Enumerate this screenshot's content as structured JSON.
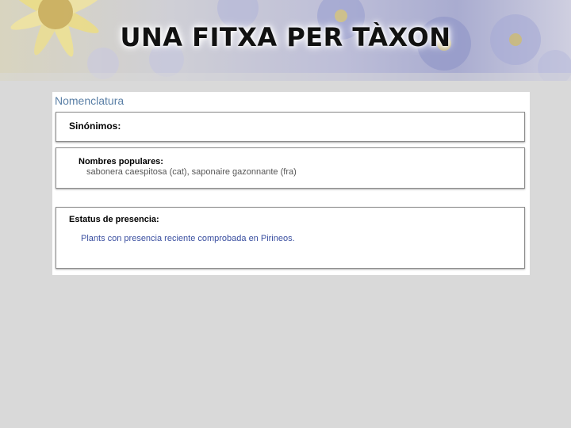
{
  "slide": {
    "title": "UNA FITXA PER TÀXON"
  },
  "panel": {
    "title": "Nomenclatura",
    "sections": [
      {
        "label": "Sinónimos:",
        "value": ""
      },
      {
        "label": "Nombres populares:",
        "value": "sabonera caespitosa (cat), saponaire gazonnante (fra)"
      },
      {
        "label": "Estatus de presencia:",
        "value": "Plants con presencia reciente comprobada en Pirineos."
      }
    ]
  },
  "colors": {
    "panel_title": "#5a7fa6",
    "presence_text": "#3a4fa0",
    "background": "#d9d9d9"
  }
}
